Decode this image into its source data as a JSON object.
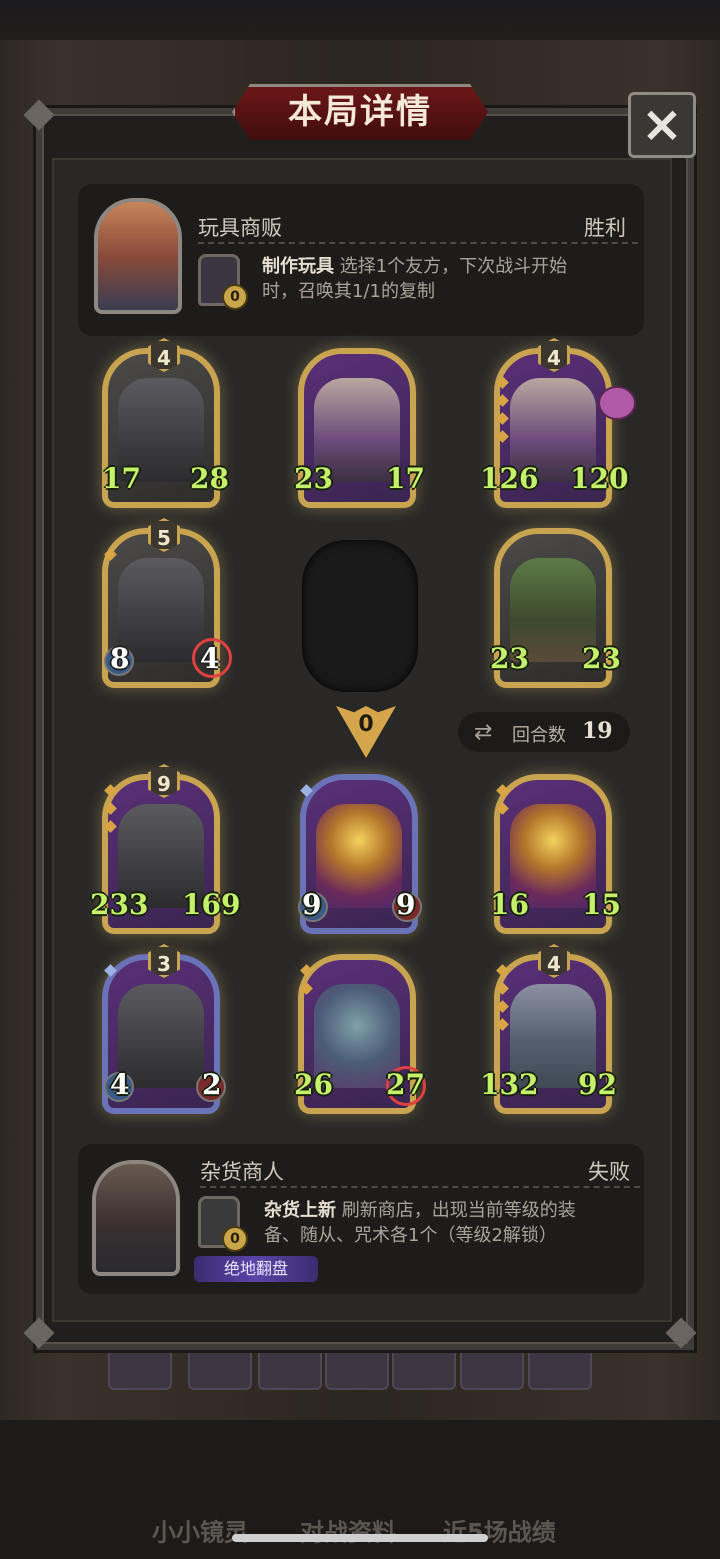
{
  "title": "本局详情",
  "close_icon": "×",
  "top_player": {
    "name": "玩具商贩",
    "result": "胜利",
    "skill_level": "0",
    "skill_name": "制作玩具",
    "skill_desc_line1": "选择1个友方，下次战斗开始",
    "skill_desc_line2": "时，召唤其1/1的复制"
  },
  "top_board": [
    {
      "level": "4",
      "atk": "17",
      "hp": "28",
      "art": "shield"
    },
    {
      "level": "",
      "atk": "23",
      "hp": "17",
      "art": "dwarf"
    },
    {
      "level": "4",
      "atk": "126",
      "hp": "120",
      "art": "dwarf"
    },
    {
      "level": "5",
      "atk": "8",
      "hp": "4",
      "art": "shield"
    },
    {
      "level": "",
      "atk": "23",
      "hp": "23",
      "art": "orc"
    }
  ],
  "attack_counter": "0",
  "rounds": {
    "label": "回合数",
    "value": "19"
  },
  "bottom_board": [
    {
      "level": "9",
      "atk": "233",
      "hp": "169",
      "art": "shield"
    },
    {
      "level": "",
      "atk": "9",
      "hp": "9",
      "art": "dragon"
    },
    {
      "level": "",
      "atk": "16",
      "hp": "15",
      "art": "dragon"
    },
    {
      "level": "3",
      "atk": "4",
      "hp": "2",
      "art": "shield"
    },
    {
      "level": "",
      "atk": "26",
      "hp": "27",
      "art": "beast"
    },
    {
      "level": "4",
      "atk": "132",
      "hp": "92",
      "art": "knight"
    }
  ],
  "bottom_player": {
    "name": "杂货商人",
    "result": "失败",
    "skill_level": "0",
    "skill_name": "杂货上新",
    "skill_desc_line1": "刷新商店，出现当前等级的装",
    "skill_desc_line2": "备、随从、咒术各1个（等级2解锁）",
    "tag": "绝地翻盘"
  },
  "bottom_tabs": [
    "小小镜灵",
    "对战资料",
    "近5场战绩"
  ],
  "colors": {
    "gold_frame": "#c9a450",
    "stat_green": "#c4f06a",
    "title_red": "#6b1717",
    "purple_tag": "#5b44a8"
  }
}
